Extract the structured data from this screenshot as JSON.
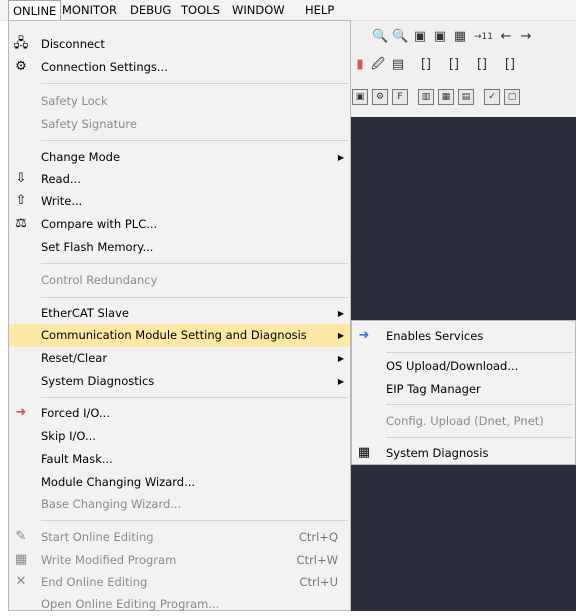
{
  "menubar": {
    "items": [
      "ONLINE",
      "MONITOR",
      "DEBUG",
      "TOOLS",
      "WINDOW",
      "HELP"
    ]
  },
  "toolbar": {
    "row1": [
      "🔍",
      "🔍",
      "▣",
      "▣",
      "▦",
      "→11",
      "←",
      "→"
    ],
    "row2": [
      "▮",
      "🖉",
      "▤",
      "[]",
      "[]",
      "[]",
      "[]"
    ],
    "row3": [
      "▣",
      "⚙",
      "F",
      "▥",
      "▦",
      "▤",
      "✓",
      "▢"
    ]
  },
  "menu": {
    "items": [
      {
        "label": "Disconnect",
        "icon": "disconnect-icon",
        "glyph": "🖧",
        "disabled": false
      },
      {
        "label": "Connection Settings...",
        "icon": "connection-settings-icon",
        "glyph": "⚙",
        "disabled": false
      },
      {
        "label": "Safety Lock",
        "disabled": true
      },
      {
        "label": "Safety Signature",
        "disabled": true
      },
      {
        "label": "Change Mode",
        "submenu": true,
        "disabled": false
      },
      {
        "label": "Read...",
        "icon": "read-icon",
        "glyph": "⇩",
        "disabled": false
      },
      {
        "label": "Write...",
        "icon": "write-icon",
        "glyph": "⇧",
        "disabled": false
      },
      {
        "label": "Compare with PLC...",
        "icon": "compare-icon",
        "glyph": "⚖",
        "disabled": false
      },
      {
        "label": "Set Flash Memory...",
        "disabled": false
      },
      {
        "label": "Control Redundancy",
        "disabled": true
      },
      {
        "label": "EtherCAT Slave",
        "submenu": true,
        "disabled": false
      },
      {
        "label": "Communication Module Setting and Diagnosis",
        "submenu": true,
        "highlight": true,
        "disabled": false
      },
      {
        "label": "Reset/Clear",
        "submenu": true,
        "disabled": false
      },
      {
        "label": "System Diagnostics",
        "submenu": true,
        "disabled": false
      },
      {
        "label": "Forced I/O...",
        "icon": "forced-io-icon",
        "glyph": "➜",
        "disabled": false
      },
      {
        "label": "Skip I/O...",
        "disabled": false
      },
      {
        "label": "Fault Mask...",
        "disabled": false
      },
      {
        "label": "Module Changing Wizard...",
        "disabled": false
      },
      {
        "label": "Base Changing Wizard...",
        "disabled": true
      },
      {
        "label": "Start Online Editing",
        "accel": "Ctrl+Q",
        "icon": "start-online-editing-icon",
        "glyph": "✎",
        "disabled": true
      },
      {
        "label": "Write Modified Program",
        "accel": "Ctrl+W",
        "icon": "write-modified-program-icon",
        "glyph": "▦",
        "disabled": true
      },
      {
        "label": "End Online Editing",
        "accel": "Ctrl+U",
        "icon": "end-online-editing-icon",
        "glyph": "✕",
        "disabled": true
      },
      {
        "label": "Open Online Editing Program...",
        "disabled": true
      }
    ]
  },
  "submenu": {
    "items": [
      {
        "label": "Enables Services",
        "icon": "enables-services-icon",
        "glyph": "➜",
        "disabled": false
      },
      {
        "label": "OS Upload/Download...",
        "disabled": false
      },
      {
        "label": "EIP Tag Manager",
        "disabled": false
      },
      {
        "label": "Config. Upload (Dnet, Pnet)",
        "disabled": true
      },
      {
        "label": "System Diagnosis",
        "icon": "system-diagnosis-icon",
        "glyph": "▦",
        "disabled": false
      }
    ]
  },
  "colors": {
    "highlight": "#fde9a6",
    "dark_area": "#2b2d3f",
    "menu_bg": "#f2f2f2"
  }
}
